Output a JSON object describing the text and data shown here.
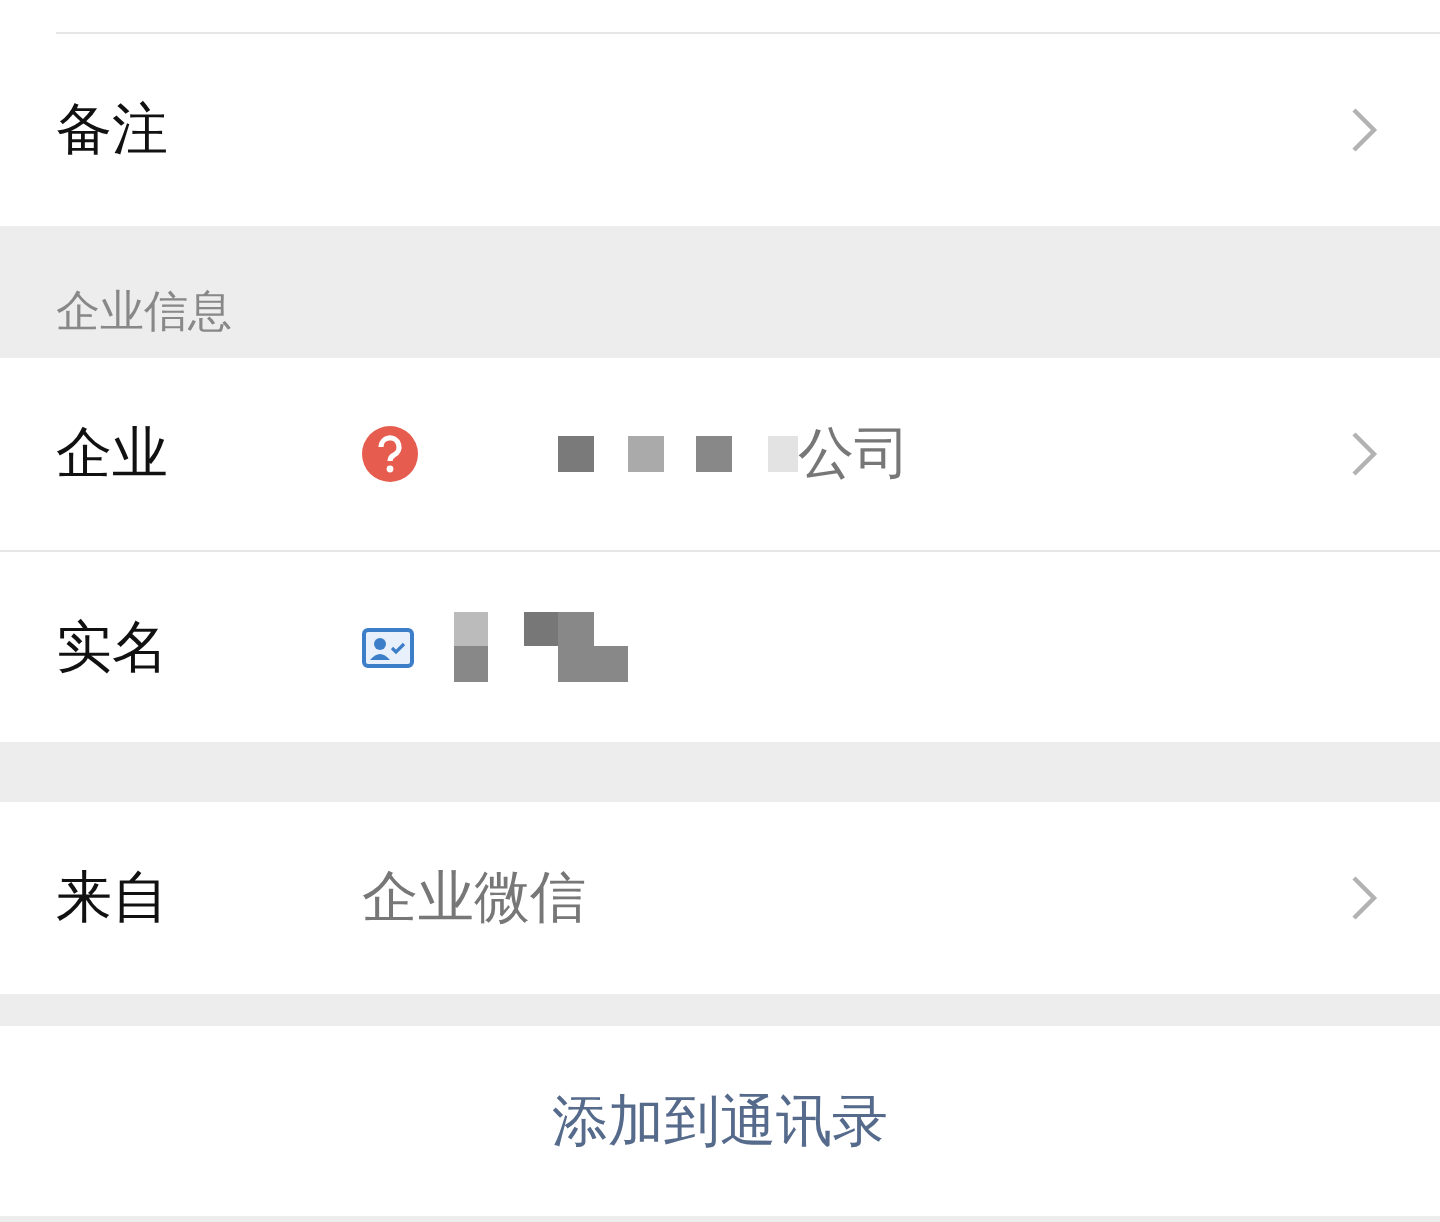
{
  "sections": [
    {
      "rows": [
        {
          "label": "备注",
          "kind": "plain",
          "chevron": true
        }
      ]
    },
    {
      "header": "企业信息",
      "rows": [
        {
          "label": "企业",
          "kind": "company",
          "value": "公司",
          "chevron": true
        },
        {
          "label": "实名",
          "kind": "verified",
          "chevron": false
        }
      ]
    },
    {
      "rows": [
        {
          "label": "来自",
          "kind": "plain",
          "value": "企业微信",
          "chevron": true
        }
      ]
    }
  ],
  "action": {
    "label": "添加到通讯录"
  }
}
